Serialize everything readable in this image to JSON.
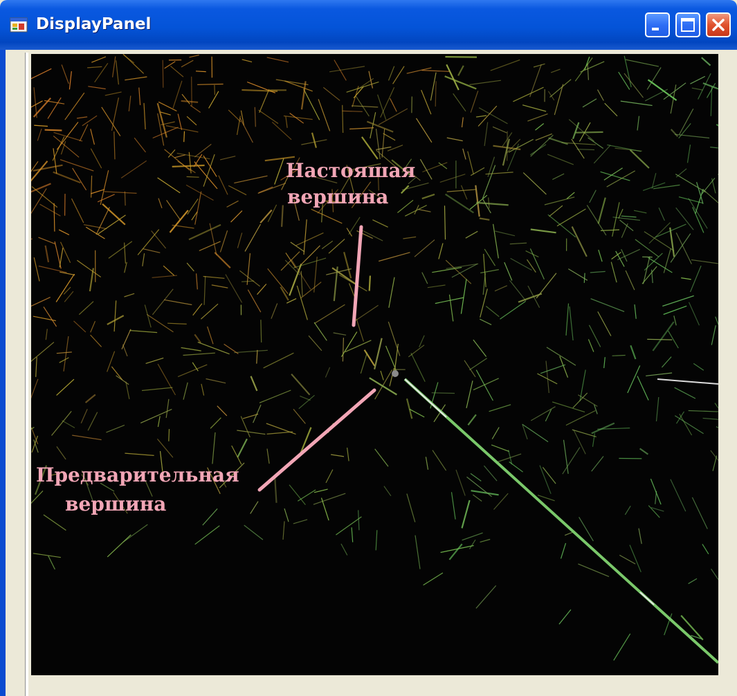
{
  "window": {
    "title": "DisplayPanel",
    "icons": {
      "app": "window-app-icon",
      "minimize": "minimize-icon",
      "maximize": "maximize-icon",
      "close": "close-icon"
    },
    "colors": {
      "titlebar": "#0454d8",
      "canvas_background": "#040404",
      "annotation": "#f2a6b6"
    }
  },
  "annotations": {
    "true_vertex": {
      "line1": "Настояшая",
      "line2": "вершина"
    },
    "preliminary_vertex": {
      "line1": "Предварительная",
      "line2": "вершина"
    }
  }
}
